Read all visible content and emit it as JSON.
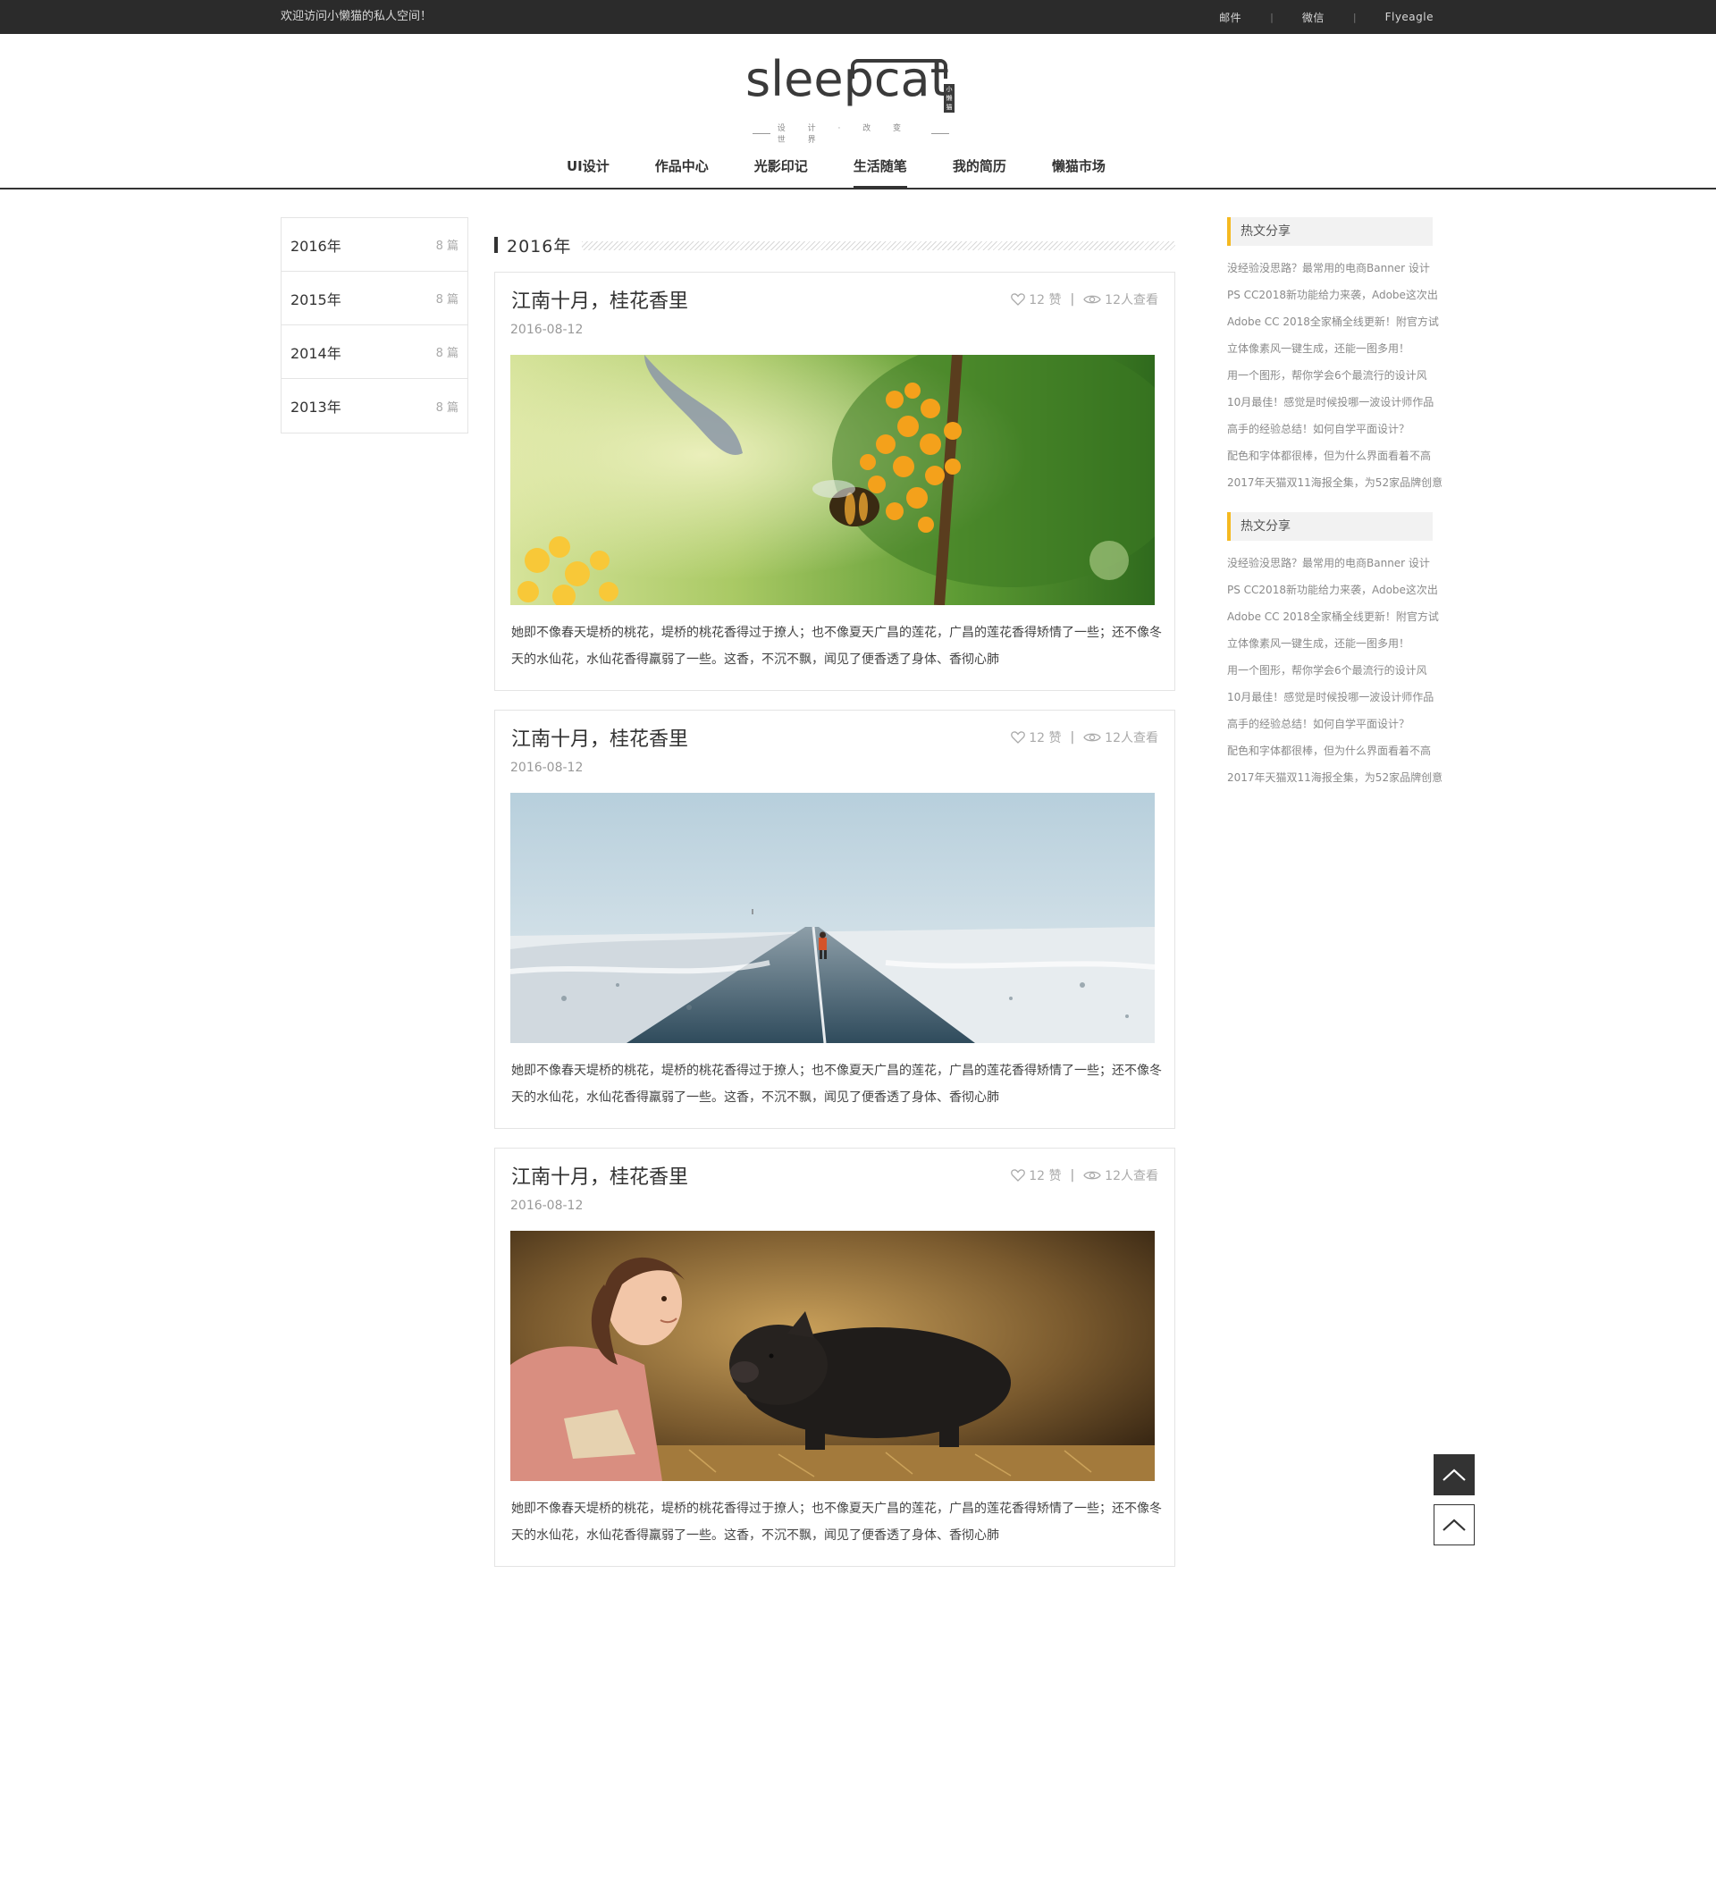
{
  "topbar": {
    "welcome": "欢迎访问小懒猫的私人空间！",
    "links": [
      "邮件",
      "微信",
      "Flyeagle"
    ],
    "separator": "|"
  },
  "logo": {
    "word": "sleepcat",
    "badge": "小懒猫",
    "slogan": "设 计 · 改 变 世 界"
  },
  "nav": {
    "items": [
      {
        "label": "UI设计"
      },
      {
        "label": "作品中心"
      },
      {
        "label": "光影印记"
      },
      {
        "label": "生活随笔",
        "active": true
      },
      {
        "label": "我的简历"
      },
      {
        "label": "懒猫市场"
      }
    ]
  },
  "archive": [
    {
      "year": "2016年",
      "count": "8 篇"
    },
    {
      "year": "2015年",
      "count": "8 篇"
    },
    {
      "year": "2014年",
      "count": "8 篇"
    },
    {
      "year": "2013年",
      "count": "8 篇"
    }
  ],
  "section": {
    "title": "2016年"
  },
  "posts": [
    {
      "title": "江南十月，桂花香里",
      "likes": "12 赞",
      "views": "12人查看",
      "date": "2016-08-12",
      "image": "bee-on-osmanthus-photo",
      "excerpt": "她即不像春天堤桥的桃花，堤桥的桃花香得过于撩人；也不像夏天广昌的莲花，广昌的莲花香得矫情了一些；还不像冬天的水仙花，水仙花香得羸弱了一些。这香，不沉不飘，闻见了便香透了身体、香彻心肺"
    },
    {
      "title": "江南十月，桂花香里",
      "likes": "12 赞",
      "views": "12人查看",
      "date": "2016-08-12",
      "image": "snowy-road-photo",
      "excerpt": "她即不像春天堤桥的桃花，堤桥的桃花香得过于撩人；也不像夏天广昌的莲花，广昌的莲花香得矫情了一些；还不像冬天的水仙花，水仙花香得羸弱了一些。这香，不沉不飘，闻见了便香透了身体、香彻心肺"
    },
    {
      "title": "江南十月，桂花香里",
      "likes": "12 赞",
      "views": "12人查看",
      "date": "2016-08-12",
      "image": "girl-and-pig-photo",
      "excerpt": "她即不像春天堤桥的桃花，堤桥的桃花香得过于撩人；也不像夏天广昌的莲花，广昌的莲花香得矫情了一些；还不像冬天的水仙花，水仙花香得羸弱了一些。这香，不沉不飘，闻见了便香透了身体、香彻心肺"
    }
  ],
  "sidebar": {
    "blocks": [
      {
        "title": "热文分享",
        "items": [
          "没经验没思路？最常用的电商Banner 设计",
          "PS CC2018新功能给力来袭，Adobe这次出",
          "Adobe CC 2018全家桶全线更新！附官方试",
          "立体像素风一键生成，还能一图多用！",
          "用一个图形，帮你学会6个最流行的设计风",
          "10月最佳！感觉是时候投哪一波设计师作品",
          "高手的经验总结！如何自学平面设计？",
          "配色和字体都很棒，但为什么界面看着不高",
          "2017年天猫双11海报全集，为52家品牌创意"
        ]
      },
      {
        "title": "热文分享",
        "items": [
          "没经验没思路？最常用的电商Banner 设计",
          "PS CC2018新功能给力来袭，Adobe这次出",
          "Adobe CC 2018全家桶全线更新！附官方试",
          "立体像素风一键生成，还能一图多用！",
          "用一个图形，帮你学会6个最流行的设计风",
          "10月最佳！感觉是时候投哪一波设计师作品",
          "高手的经验总结！如何自学平面设计？",
          "配色和字体都很棒，但为什么界面看着不高",
          "2017年天猫双11海报全集，为52家品牌创意"
        ]
      }
    ]
  },
  "colors": {
    "topbar": "#2b2b2b",
    "accent": "#f5b920",
    "text": "#333333"
  },
  "icons": {
    "like": "heart-icon",
    "views": "eye-icon",
    "back_to_top": "chevron-up-icon"
  }
}
